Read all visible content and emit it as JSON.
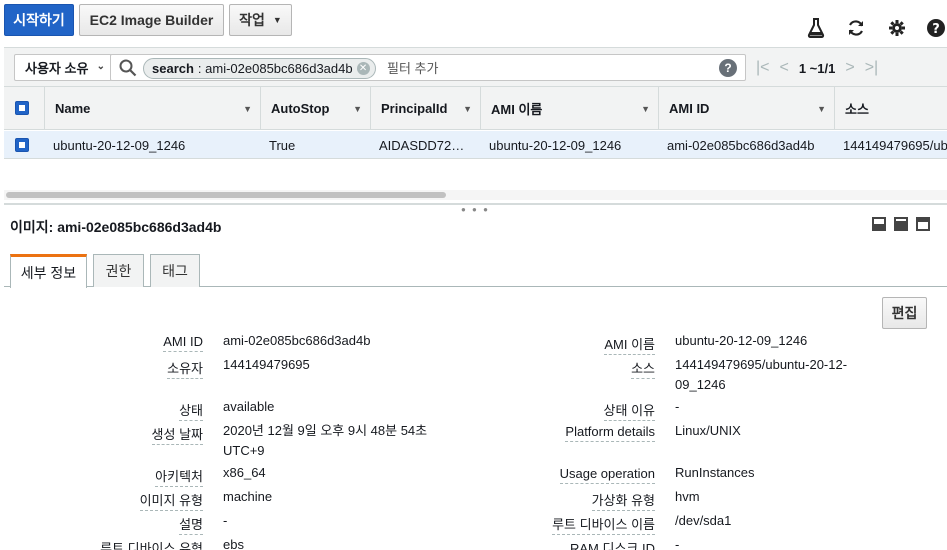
{
  "toolbar": {
    "launch_label": "시작하기",
    "image_builder_label": "EC2 Image Builder",
    "actions_label": "작업",
    "icons": [
      "flask-icon",
      "refresh-icon",
      "gear-icon",
      "help-icon"
    ]
  },
  "filter": {
    "owner_label": "사용자 소유",
    "token_key": "search",
    "token_value": ": ami-02e085bc686d3ad4b",
    "placeholder": "필터 추가",
    "pager_range": "1 ~1/1"
  },
  "table": {
    "columns": [
      "Name",
      "AutoStop",
      "PrincipalId",
      "AMI 이름",
      "AMI ID",
      "소스"
    ],
    "rows": [
      [
        "ubuntu-20-12-09_1246",
        "True",
        "AIDASDD72…",
        "ubuntu-20-12-09_1246",
        "ami-02e085bc686d3ad4b",
        "144149479695/ub"
      ]
    ]
  },
  "detail": {
    "title": "이미지: ami-02e085bc686d3ad4b",
    "tabs": [
      "세부 정보",
      "권한",
      "태그"
    ],
    "edit_label": "편집",
    "left_fields": [
      {
        "label": "AMI ID",
        "value": "ami-02e085bc686d3ad4b"
      },
      {
        "label": "소유자",
        "value": "144149479695"
      },
      {
        "label": "상태",
        "value": "available"
      },
      {
        "label": "생성 날짜",
        "value": "2020년 12월 9일 오후 9시 48분 54초",
        "value2": "UTC+9"
      },
      {
        "label": "아키텍처",
        "value": "x86_64"
      },
      {
        "label": "이미지 유형",
        "value": "machine"
      },
      {
        "label": "설명",
        "value": "-"
      },
      {
        "label": "루트 디바이스 유형",
        "value": "ebs"
      }
    ],
    "right_fields": [
      {
        "label": "AMI 이름",
        "value": "ubuntu-20-12-09_1246"
      },
      {
        "label": "소스",
        "value": "144149479695/ubuntu-20-12-",
        "value2": "09_1246"
      },
      {
        "label": "상태 이유",
        "value": "-"
      },
      {
        "label": "Platform details",
        "value": "Linux/UNIX"
      },
      {
        "label": "Usage operation",
        "value": "RunInstances"
      },
      {
        "label": "가상화 유형",
        "value": "hvm"
      },
      {
        "label": "루트 디바이스 이름",
        "value": "/dev/sda1"
      },
      {
        "label": "RAM 디스크 ID",
        "value": "-"
      }
    ]
  }
}
